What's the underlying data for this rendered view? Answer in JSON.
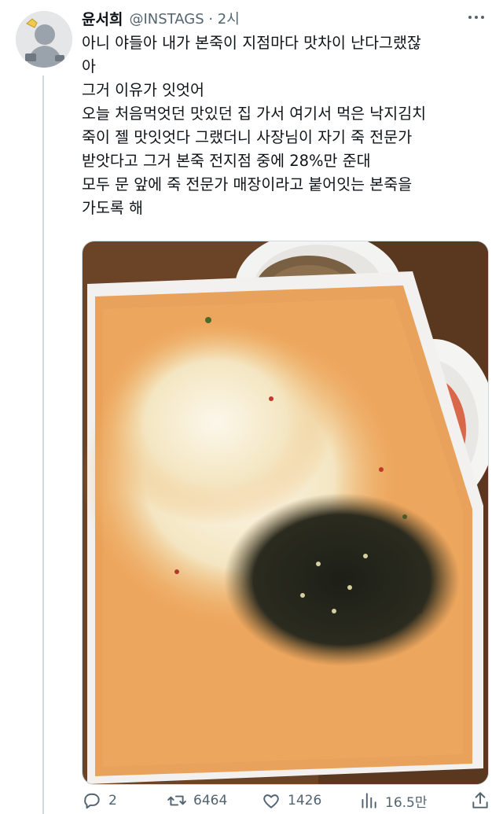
{
  "tweet": {
    "display_name": "윤서희",
    "handle_time": "@INSTAGS · 2시",
    "text": "아니 야들아 내가 본죽이 지점마다 맛차이 난다그랬잖\n아\n그거 이유가 잇엇어\n오늘 처음먹엇던 맛있던 집 가서 여기서 먹은 낙지김치\n죽이 젤 맛잇엇다 그랬더니 사장님이 자기 죽 전문가\n받앗다고 그거 본죽 전지점 중에 28%만 준대\n모두 문 앞에 죽 전문가 매장이라고 붙어잇는 본죽을\n가도록 해"
  },
  "actions": {
    "replies": "2",
    "retweets": "6464",
    "likes": "1426",
    "views": "16.5만"
  },
  "icons": [
    "more-icon",
    "reply-icon",
    "retweet-icon",
    "like-icon",
    "views-icon",
    "share-icon"
  ],
  "colors": {
    "muted": "#536471",
    "text": "#0f1419",
    "border": "#cfd9de"
  }
}
